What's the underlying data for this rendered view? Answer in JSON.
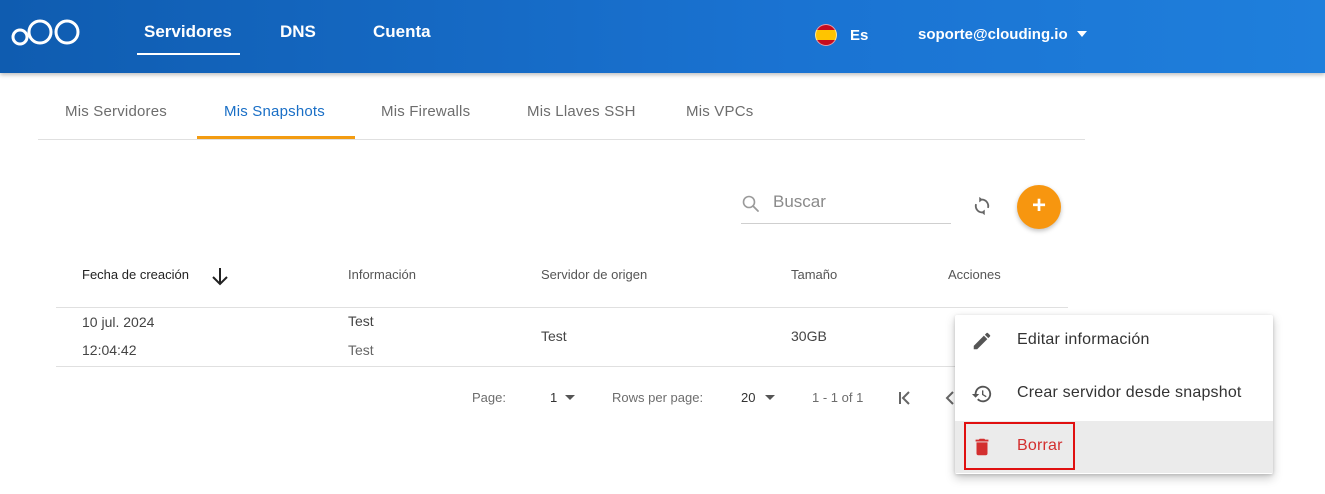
{
  "header": {
    "nav": [
      {
        "label": "Servidores",
        "active": true
      },
      {
        "label": "DNS",
        "active": false
      },
      {
        "label": "Cuenta",
        "active": false
      }
    ],
    "language": "Es",
    "user_email": "soporte@clouding.io"
  },
  "tabs": [
    {
      "label": "Mis Servidores",
      "active": false
    },
    {
      "label": "Mis Snapshots",
      "active": true
    },
    {
      "label": "Mis Firewalls",
      "active": false
    },
    {
      "label": "Mis Llaves SSH",
      "active": false
    },
    {
      "label": "Mis VPCs",
      "active": false
    }
  ],
  "toolbar": {
    "search_placeholder": "Buscar",
    "add_label": "+"
  },
  "table": {
    "columns": [
      "Fecha de creación",
      "Información",
      "Servidor de origen",
      "Tamaño",
      "Acciones"
    ],
    "rows": [
      {
        "date": "10 jul. 2024",
        "time": "12:04:42",
        "info_1": "Test",
        "info_2": "Test",
        "origin": "Test",
        "size": "30GB"
      }
    ]
  },
  "pagination": {
    "page_label": "Page:",
    "page_value": "1",
    "rows_label": "Rows per page:",
    "rows_value": "20",
    "range": "1 - 1 of 1"
  },
  "action_menu": {
    "items": [
      {
        "label": "Editar información",
        "icon": "pencil-icon"
      },
      {
        "label": "Crear servidor desde snapshot",
        "icon": "history-icon"
      },
      {
        "label": "Borrar",
        "icon": "trash-icon"
      }
    ]
  },
  "colors": {
    "header_start": "#0f5cb0",
    "header_end": "#1f7fdc",
    "active_tab": "#1a6fc6",
    "tab_underline": "#f39c12",
    "add_button": "#f7960f",
    "danger": "#d32f2f",
    "highlight_border": "#e01010"
  }
}
